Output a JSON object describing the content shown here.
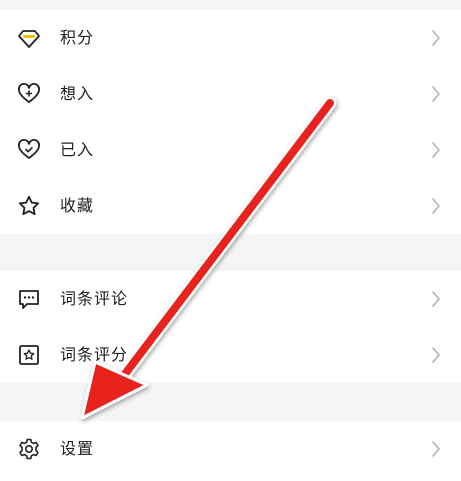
{
  "menu_groups": [
    {
      "items": [
        {
          "label": "积分",
          "icon": "diamond-icon"
        },
        {
          "label": "想入",
          "icon": "heart-plus-icon"
        },
        {
          "label": "已入",
          "icon": "heart-check-icon"
        },
        {
          "label": "收藏",
          "icon": "star-icon"
        }
      ]
    },
    {
      "items": [
        {
          "label": "词条评论",
          "icon": "comment-icon"
        },
        {
          "label": "词条评分",
          "icon": "rating-star-icon"
        }
      ]
    },
    {
      "items": [
        {
          "label": "设置",
          "icon": "gear-icon"
        }
      ]
    }
  ],
  "chevron_icon": "chevron-right-icon",
  "annotation": {
    "type": "red-arrow",
    "color": "#e8201e",
    "points_to": "设置"
  },
  "colors": {
    "background": "#f4f5f7",
    "card": "#ffffff",
    "text": "#222222",
    "chevron": "#b3b3b3",
    "accent_yellow": "#f2c200"
  }
}
